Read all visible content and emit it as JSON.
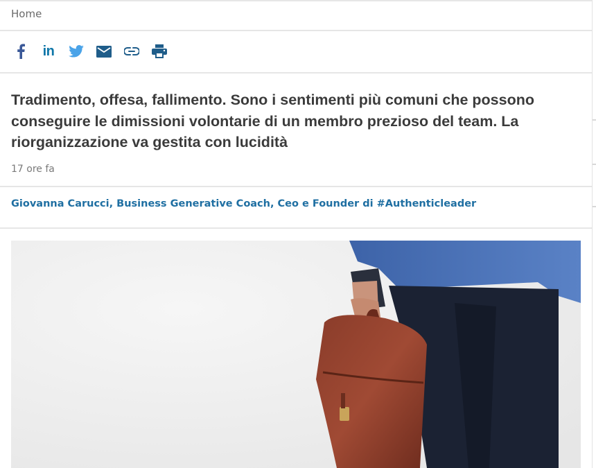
{
  "breadcrumb": {
    "home": "Home"
  },
  "share": {
    "icons": [
      "facebook-icon",
      "linkedin-icon",
      "twitter-icon",
      "email-icon",
      "link-icon",
      "print-icon"
    ],
    "linkedin_label": "in",
    "colors": {
      "facebook": "#3b5998",
      "linkedin": "#0e76a8",
      "twitter": "#4aa3e8",
      "email": "#1f5d8a",
      "link": "#1f5d8a",
      "print": "#1f5d8a"
    }
  },
  "article": {
    "headline": "Tradimento, offesa, fallimento. Sono i sentimenti più comuni che possono conseguire le dimissioni volontarie di un membro prezioso del team. La riorganizzazione va gestita con lucidità",
    "timestamp": "17 ore fa",
    "author": "Giovanna Carucci, Business Generative Coach, Ceo e Founder di #Authenticleader"
  },
  "colors": {
    "author_link": "#1f6fa2",
    "headline": "#3b3b3b",
    "divider": "#e6e6e6"
  }
}
